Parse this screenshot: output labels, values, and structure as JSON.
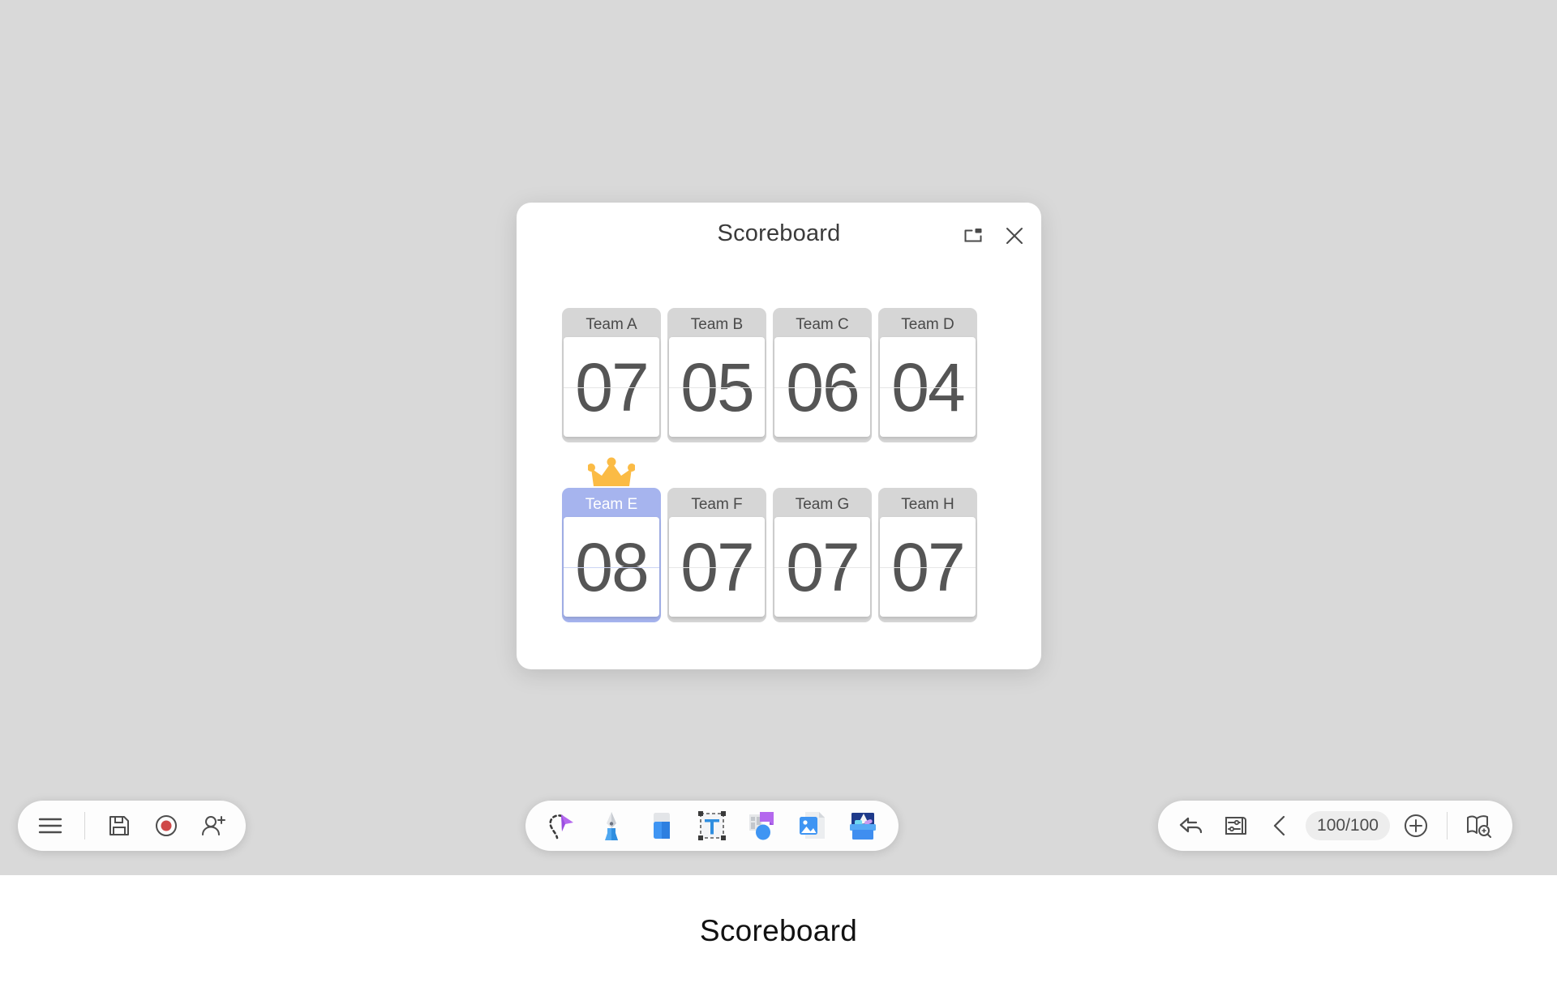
{
  "app": {
    "canvas_background": "#d9d9d9",
    "page_caption": "Scoreboard"
  },
  "dialog": {
    "title": "Scoreboard",
    "popout_icon": "popout-window-icon",
    "close_icon": "close-icon",
    "winner_icon": "crown-icon",
    "winner_team": "Team E",
    "highlight_color": "#a6b4ee",
    "crown_color": "#fbbb45",
    "card_color": "#d6d6d6",
    "digit_color": "#555555",
    "teams": [
      {
        "name": "Team A",
        "score": "07",
        "winner": false
      },
      {
        "name": "Team B",
        "score": "05",
        "winner": false
      },
      {
        "name": "Team C",
        "score": "06",
        "winner": false
      },
      {
        "name": "Team D",
        "score": "04",
        "winner": false
      },
      {
        "name": "Team E",
        "score": "08",
        "winner": true
      },
      {
        "name": "Team F",
        "score": "07",
        "winner": false
      },
      {
        "name": "Team G",
        "score": "07",
        "winner": false
      },
      {
        "name": "Team H",
        "score": "07",
        "winner": false
      }
    ]
  },
  "toolbar_left": {
    "items": [
      {
        "icon": "hamburger-menu-icon",
        "label": "Menu"
      },
      {
        "icon": "save-floppy-icon",
        "label": "Save"
      },
      {
        "icon": "record-icon",
        "label": "Record"
      },
      {
        "icon": "add-user-icon",
        "label": "Invite"
      }
    ]
  },
  "toolbar_center": {
    "items": [
      {
        "icon": "lasso-select-icon",
        "label": "Select"
      },
      {
        "icon": "pen-icon",
        "label": "Pen"
      },
      {
        "icon": "eraser-icon",
        "label": "Eraser"
      },
      {
        "icon": "text-tool-icon",
        "label": "Text"
      },
      {
        "icon": "shapes-icon",
        "label": "Shapes"
      },
      {
        "icon": "image-insert-icon",
        "label": "Image"
      },
      {
        "icon": "toolbox-icon",
        "label": "More tools"
      }
    ]
  },
  "toolbar_right": {
    "undo_icon": "undo-arrow-icon",
    "settings_icon": "page-settings-icon",
    "prev_page_icon": "chevron-left-icon",
    "page_indicator": "100/100",
    "add_page_icon": "plus-circle-icon",
    "overview_icon": "page-overview-icon"
  }
}
